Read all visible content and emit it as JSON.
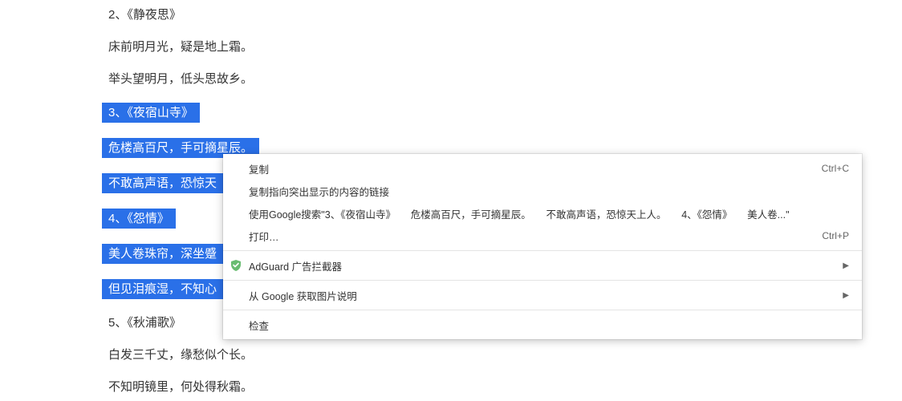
{
  "content": {
    "lines": [
      {
        "text": "2、《静夜思》",
        "selected": false
      },
      {
        "text": "床前明月光，疑是地上霜。",
        "selected": false
      },
      {
        "text": "举头望明月，低头思故乡。",
        "selected": false
      },
      {
        "text": "3、《夜宿山寺》",
        "selected": true
      },
      {
        "text": "危楼高百尺，手可摘星辰。",
        "selected": true
      },
      {
        "text": "不敢高声语，恐惊天",
        "selected": true,
        "truncated": true
      },
      {
        "text": "4、《怨情》",
        "selected": true
      },
      {
        "text": "美人卷珠帘，深坐蹙",
        "selected": true,
        "truncated": true
      },
      {
        "text": "但见泪痕湿，不知心",
        "selected": true,
        "truncated": true
      },
      {
        "text": "5、《秋浦歌》",
        "selected": false
      },
      {
        "text": "白发三千丈，缘愁似个长。",
        "selected": false
      },
      {
        "text": "不知明镜里，何处得秋霜。",
        "selected": false
      }
    ]
  },
  "menu": {
    "copy": "复制",
    "copy_shortcut": "Ctrl+C",
    "copy_link": "复制指向突出显示的内容的链接",
    "search": "使用Google搜索\"3、《夜宿山寺》　　危楼高百尺，手可摘星辰。　　不敢高声语，恐惊天上人。　　4、《怨情》　　美人卷...\"",
    "print": "打印…",
    "print_shortcut": "Ctrl+P",
    "adguard": "AdGuard 广告拦截器",
    "get_image_desc": "从 Google 获取图片说明",
    "inspect": "检查"
  },
  "icons": {
    "adguard_color": "#68bc71"
  }
}
